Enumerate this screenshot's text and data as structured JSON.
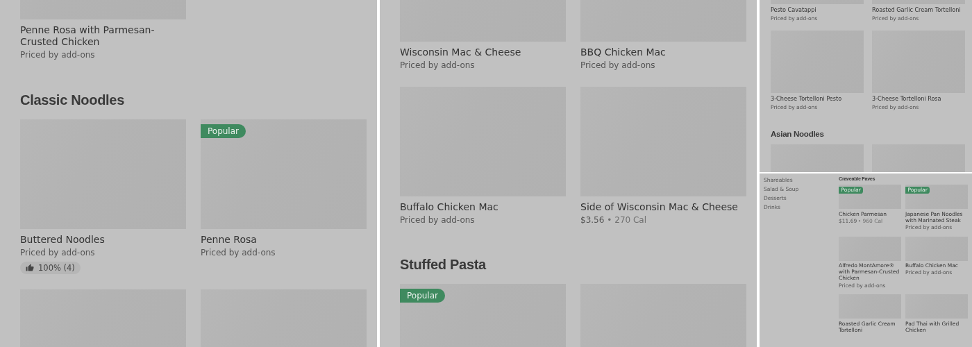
{
  "panels": [
    {
      "kind": "listing",
      "blocks": [
        {
          "kind": "grid",
          "items": [
            {
              "name": "Penne Rosa with Parmesan-Crusted Chicken",
              "price": "Priced by add-ons"
            }
          ]
        },
        {
          "kind": "heading",
          "text": "Classic Noodles"
        },
        {
          "kind": "grid",
          "items": [
            {
              "name": "Buttered Noodles",
              "price": "Priced by add-ons",
              "rating": "100% (4)"
            },
            {
              "name": "Penne Rosa",
              "price": "Priced by add-ons",
              "badge": "Popular"
            }
          ]
        },
        {
          "kind": "image_row"
        }
      ]
    },
    {
      "kind": "listing",
      "blocks": [
        {
          "kind": "grid",
          "items": [
            {
              "name": "Wisconsin Mac & Cheese",
              "price": "Priced by add-ons"
            },
            {
              "name": "BBQ Chicken Mac",
              "price": "Priced by add-ons"
            }
          ]
        },
        {
          "kind": "grid",
          "items": [
            {
              "name": "Buffalo Chicken Mac",
              "price": "Priced by add-ons"
            },
            {
              "name": "Side of Wisconsin Mac & Cheese",
              "price": "$3.56",
              "calories": "• 270 Cal"
            }
          ]
        },
        {
          "kind": "heading",
          "text": "Stuffed Pasta"
        },
        {
          "kind": "image_row",
          "badge": "Popular"
        }
      ]
    },
    {
      "kind": "listing",
      "blocks": [
        {
          "kind": "grid",
          "items": [
            {
              "name": "Pesto Cavatappi",
              "price": "Priced by add-ons"
            },
            {
              "name": "Roasted Garlic Cream Tortelloni",
              "price": "Priced by add-ons"
            }
          ]
        },
        {
          "kind": "grid",
          "items": [
            {
              "name": "3-Cheese Tortelloni Pesto",
              "price": "Priced by add-ons"
            },
            {
              "name": "3-Cheese Tortelloni Rosa",
              "price": "Priced by add-ons"
            }
          ]
        },
        {
          "kind": "heading",
          "text": "Asian Noodles"
        },
        {
          "kind": "image_row"
        }
      ]
    },
    {
      "kind": "menu",
      "sidebar": [
        "Shareables",
        "Salad & Soup",
        "Desserts",
        "Drinks"
      ],
      "blocks": [
        {
          "kind": "heading",
          "text": "Craveable Faves"
        },
        {
          "kind": "grid",
          "items": [
            {
              "name": "Chicken Parmesan",
              "price": "$11.69",
              "calories": "• 960 Cal",
              "badge": "Popular"
            },
            {
              "name": "Japanese Pan Noodles with Marinated Steak",
              "price": "Priced by add-ons",
              "badge": "Popular"
            }
          ]
        },
        {
          "kind": "grid",
          "items": [
            {
              "name": "Alfredo MontAmore® with Parmesan-Crusted Chicken",
              "price": "Priced by add-ons"
            },
            {
              "name": "Buffalo Chicken Mac",
              "price": "Priced by add-ons"
            }
          ]
        },
        {
          "kind": "grid",
          "items": [
            {
              "name": "Roasted Garlic Cream Tortelloni"
            },
            {
              "name": "Pad Thai with Grilled Chicken"
            }
          ]
        }
      ]
    }
  ]
}
